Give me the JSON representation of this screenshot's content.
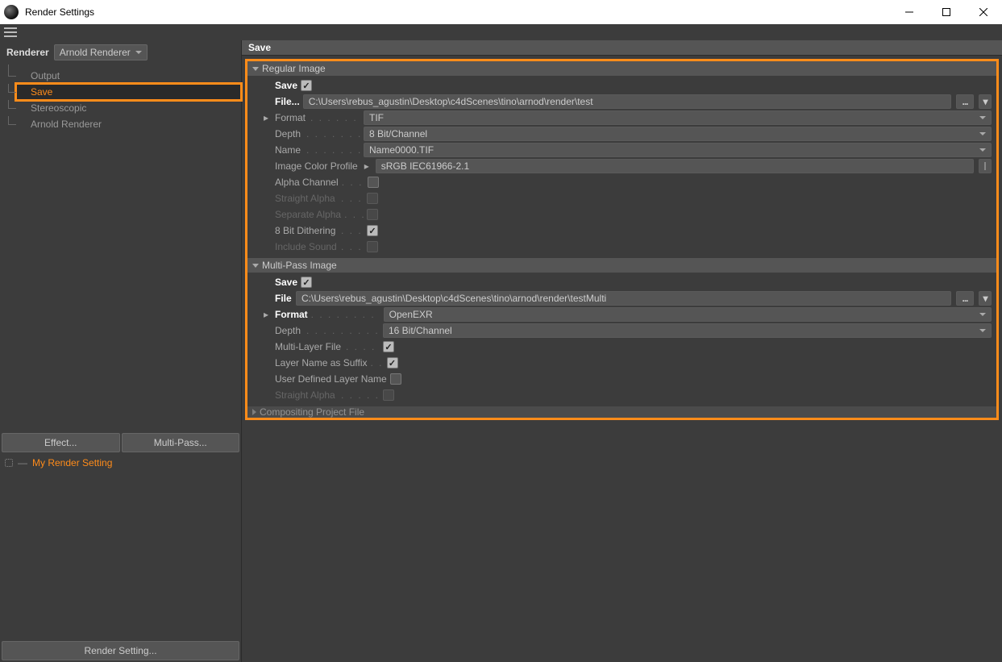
{
  "window": {
    "title": "Render Settings"
  },
  "sidebar": {
    "renderer_label": "Renderer",
    "renderer_value": "Arnold Renderer",
    "tree": [
      "Output",
      "Save",
      "Stereoscopic",
      "Arnold Renderer"
    ],
    "selected_index": 1,
    "effect_btn": "Effect...",
    "multipass_btn": "Multi-Pass...",
    "my_setting": "My Render Setting",
    "render_setting_btn": "Render Setting..."
  },
  "content": {
    "header": "Save",
    "regular": {
      "title": "Regular Image",
      "save_label": "Save",
      "save_checked": true,
      "file_label": "File...",
      "file_value": "C:\\Users\\rebus_agustin\\Desktop\\c4dScenes\\tino\\arnod\\render\\test",
      "format_label": "Format",
      "format_value": "TIF",
      "depth_label": "Depth",
      "depth_value": "8 Bit/Channel",
      "name_label": "Name",
      "name_value": "Name0000.TIF",
      "color_profile_label": "Image Color Profile",
      "color_profile_value": "sRGB IEC61966-2.1",
      "alpha_label": "Alpha Channel",
      "alpha_checked": false,
      "straight_alpha_label": "Straight Alpha",
      "separate_alpha_label": "Separate Alpha",
      "dithering_label": "8 Bit Dithering",
      "dithering_checked": true,
      "include_sound_label": "Include Sound"
    },
    "multipass": {
      "title": "Multi-Pass Image",
      "save_label": "Save",
      "save_checked": true,
      "file_label": "File",
      "file_value": "C:\\Users\\rebus_agustin\\Desktop\\c4dScenes\\tino\\arnod\\render\\testMulti",
      "format_label": "Format",
      "format_value": "OpenEXR",
      "depth_label": "Depth",
      "depth_value": "16 Bit/Channel",
      "multilayer_label": "Multi-Layer File",
      "multilayer_checked": true,
      "layer_suffix_label": "Layer Name as Suffix",
      "layer_suffix_checked": true,
      "user_layer_label": "User Defined Layer Name",
      "user_layer_checked": false,
      "straight_alpha_label": "Straight Alpha"
    },
    "compositing": {
      "title": "Compositing Project File"
    }
  }
}
